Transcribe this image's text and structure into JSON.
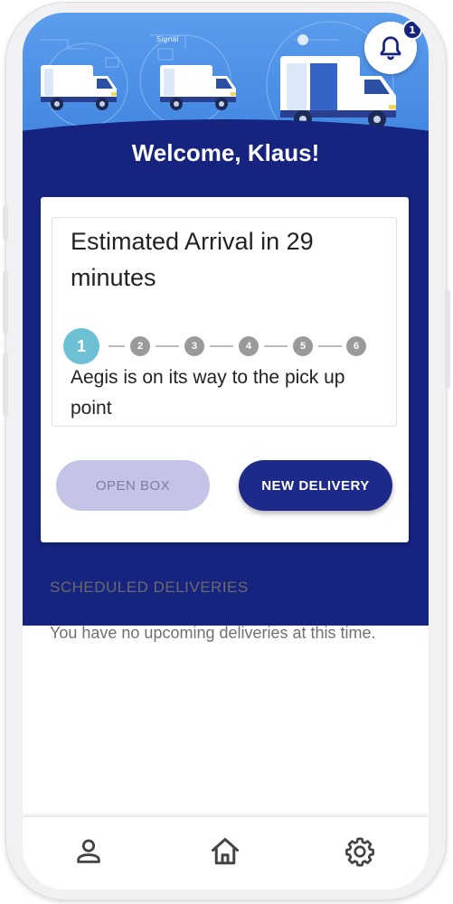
{
  "header": {
    "welcome": "Welcome, Klaus!",
    "notification_count": "1",
    "colors": {
      "sky": "#4a8fe6",
      "navy": "#16237f"
    }
  },
  "tracking": {
    "eta": "Estimated Arrival in 29 minutes",
    "steps": [
      "1",
      "2",
      "3",
      "4",
      "5",
      "6"
    ],
    "active_step": 1,
    "status": "Aegis is on its way to the pick up point"
  },
  "actions": {
    "open_box_label": "OPEN BOX",
    "new_delivery_label": "NEW DELIVERY"
  },
  "scheduled": {
    "title": "SCHEDULED DELIVERIES",
    "empty_message": "You have no upcoming deliveries at this time."
  },
  "nav": {
    "items": [
      {
        "icon": "person-icon"
      },
      {
        "icon": "home-icon"
      },
      {
        "icon": "gear-icon"
      }
    ]
  },
  "header_art_labels": [
    "Signal"
  ]
}
